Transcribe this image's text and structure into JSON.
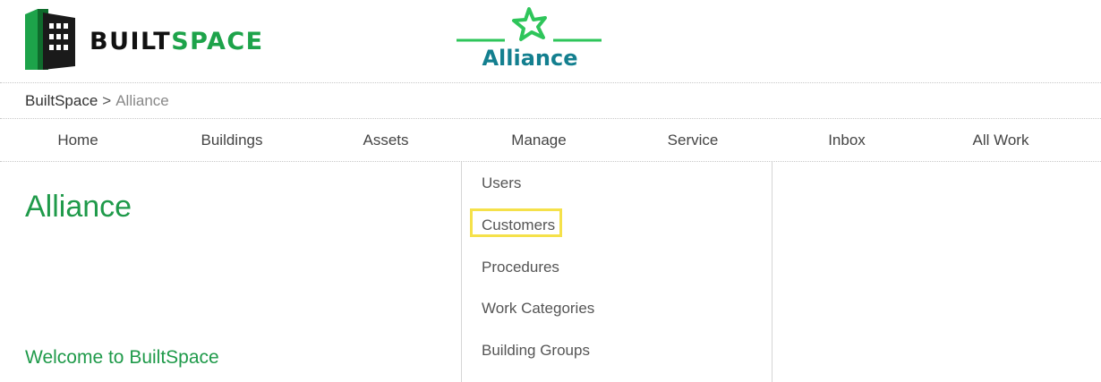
{
  "brand": {
    "part1": "BUILT",
    "part2": "SPACE"
  },
  "org_logo": {
    "name": "Alliance"
  },
  "breadcrumb": {
    "root": "BuiltSpace",
    "separator": ">",
    "current": "Alliance"
  },
  "nav": {
    "items": [
      "Home",
      "Buildings",
      "Assets",
      "Manage",
      "Service",
      "Inbox",
      "All Work"
    ]
  },
  "page": {
    "title": "Alliance",
    "welcome": "Welcome to BuiltSpace"
  },
  "manage_menu": {
    "items": [
      "Users",
      "Customers",
      "Procedures",
      "Work Categories",
      "Building Groups"
    ],
    "highlighted": "Customers"
  },
  "colors": {
    "brand_green": "#1da34a",
    "title_green": "#1f9a4a",
    "alliance_teal": "#137f8f",
    "highlight": "#f5e14a"
  }
}
